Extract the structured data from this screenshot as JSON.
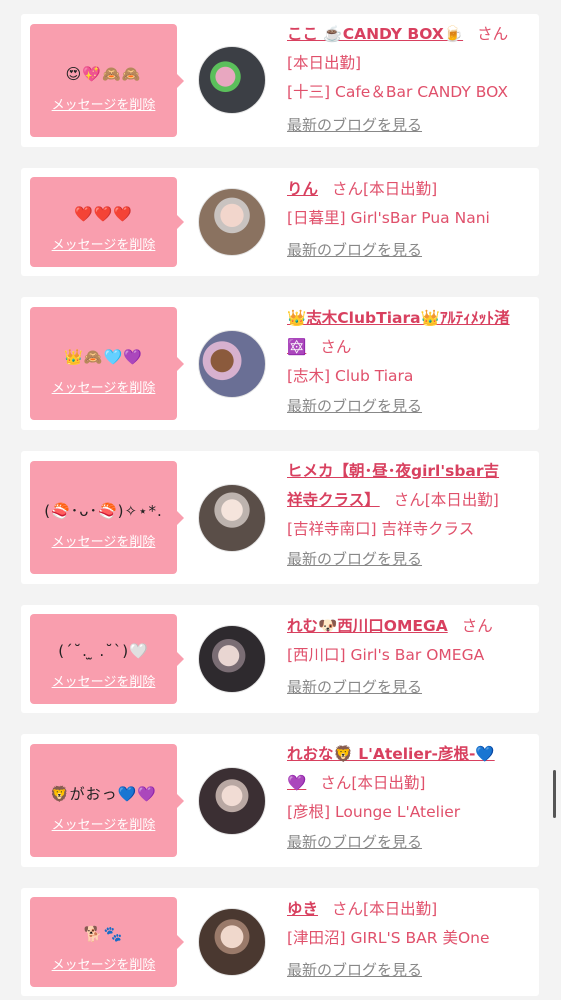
{
  "cards": [
    {
      "bubble_text": "😍💖🙈🙈",
      "delete_label": "メッセージを削除",
      "name": "ここ ☕️CANDY BOX🍺",
      "san": "さん",
      "status": "",
      "shop": "[十三] Cafe＆Bar CANDY BOX",
      "blog_link": "最新のブログを見る",
      "avatar": "#3c3f45"
    },
    {
      "bubble_text": "❤️❤️❤️",
      "delete_label": "メッセージを削除",
      "name": "りん",
      "san": "さん",
      "status": "[本日出勤]",
      "shop": "[日暮里] Girl'sBar Pua Nani",
      "blog_link": "最新のブログを見る",
      "avatar": "#8a7260"
    },
    {
      "bubble_text": "👑🙈🩵💜",
      "delete_label": "メッセージを削除",
      "name_line1": "👑志木ClubTiara👑ｱﾙﾃｨﾒｯﾄ渚",
      "name_line2": "🔯",
      "san": "さん",
      "status": "",
      "shop": "[志木] Club Tiara",
      "blog_link": "最新のブログを見る",
      "avatar": "#6a6f95"
    },
    {
      "bubble_text": "(🍣･ᴗ･🍣)✧⋆*.",
      "delete_label": "メッセージを削除",
      "name_line1": "ヒメカ【朝･昼･夜girl'sbar吉",
      "name_line2": "祥寺クラス】",
      "san": "さん",
      "status": "[本日出勤]",
      "shop": "[吉祥寺南口] 吉祥寺クラス",
      "blog_link": "最新のブログを見る",
      "avatar": "#5a4e48"
    },
    {
      "bubble_text": "(ˊ˘. ̫ .˘ˋ)🤍",
      "delete_label": "メッセージを削除",
      "name": "れむ🐶西川口OMEGA",
      "san": "さん",
      "status": "",
      "shop": "[西川口] Girl's Bar OMEGA",
      "blog_link": "最新のブログを見る",
      "avatar": "#2e2a2e"
    },
    {
      "bubble_text": "🦁がおっ💙💜",
      "delete_label": "メッセージを削除",
      "name_line1": "れおな🦁 L'Atelier-彦根-💙",
      "name_line2": "💜",
      "san": "さん",
      "status": "[本日出勤]",
      "shop": "[彦根] Lounge L'Atelier",
      "blog_link": "最新のブログを見る",
      "avatar": "#3b2f33"
    },
    {
      "bubble_text": "🐕🐾",
      "delete_label": "メッセージを削除",
      "name": "ゆき",
      "san": "さん",
      "status": "[本日出勤]",
      "shop": "[津田沼] GIRL'S BAR 美One",
      "blog_link": "最新のブログを見る",
      "avatar": "#4a3830"
    }
  ]
}
